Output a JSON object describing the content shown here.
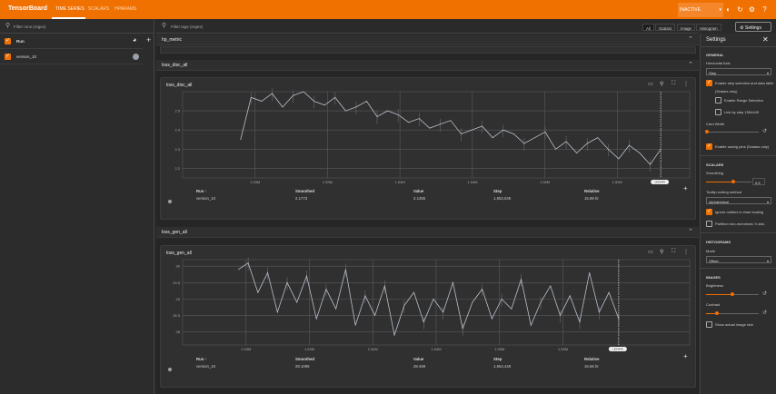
{
  "header": {
    "title": "TensorBoard",
    "tabs": [
      "TIME SERIES",
      "SCALARS",
      "HPARAMS"
    ],
    "status": "INACTIVE"
  },
  "runs": {
    "filter_placeholder": "Filter runs (regex)",
    "header": "Run",
    "items": [
      {
        "name": "version_10",
        "checked": true
      }
    ]
  },
  "main": {
    "filter_placeholder": "Filter tags (regex)",
    "chips": [
      "All",
      "Scalars",
      "Image",
      "Histogram"
    ],
    "active_chip": "All",
    "settings_button": "Settings"
  },
  "groups": {
    "hp_metric": "hp_metric",
    "disc": "loss_disc_all",
    "gen": "loss_gen_all"
  },
  "table_headers": {
    "run": "Run ↑",
    "smoothed": "Smoothed",
    "value": "Value",
    "step": "Step",
    "relative": "Relative"
  },
  "cards": [
    {
      "title": "loss_disc_all",
      "run": "version_10",
      "smoothed": "2.1773",
      "value": "2.1355",
      "step": "1,553,049",
      "relative": "15.89 hr",
      "step_label": "1553049"
    },
    {
      "title": "loss_gen_all",
      "run": "version_10",
      "smoothed": "29.1095",
      "value": "28.469",
      "step": "1,554,449",
      "relative": "16.65 hr",
      "step_label": "1554449"
    }
  ],
  "chart_data": [
    {
      "type": "line",
      "title": "loss_disc_all",
      "xlim": [
        1525000,
        1560000
      ],
      "ylim": [
        2.15,
        2.6
      ],
      "yticks": [
        "2.5",
        "2.4",
        "2.3",
        "2.2"
      ],
      "ytick_values": [
        2.5,
        2.4,
        2.3,
        2.2
      ],
      "xticks": [
        "1.53M",
        "1.53M",
        "1.54M",
        "1.54M",
        "1.55M",
        "1.55M"
      ],
      "xtick_values": [
        1530000,
        1535000,
        1540000,
        1545000,
        1550000,
        1555000
      ],
      "x_start": 1529000,
      "x_end": 1558000,
      "values": [
        2.35,
        2.57,
        2.55,
        2.59,
        2.52,
        2.58,
        2.6,
        2.55,
        2.53,
        2.57,
        2.5,
        2.52,
        2.55,
        2.47,
        2.5,
        2.48,
        2.44,
        2.46,
        2.41,
        2.43,
        2.45,
        2.38,
        2.4,
        2.42,
        2.36,
        2.4,
        2.38,
        2.33,
        2.36,
        2.39,
        2.3,
        2.34,
        2.28,
        2.33,
        2.36,
        2.3,
        2.25,
        2.32,
        2.28,
        2.22,
        2.3
      ]
    },
    {
      "type": "line",
      "title": "loss_gen_all",
      "xlim": [
        1525000,
        1565000
      ],
      "ylim": [
        27.6,
        30.2
      ],
      "yticks": [
        "30",
        "29.5",
        "29",
        "28.5",
        "28"
      ],
      "ytick_values": [
        30,
        29.5,
        29,
        28.5,
        28
      ],
      "xticks": [
        "1.53M",
        "1.53M",
        "1.54M",
        "1.54M",
        "1.55M",
        "1.55M"
      ],
      "xtick_values": [
        1530000,
        1535000,
        1540000,
        1545000,
        1550000,
        1555000
      ],
      "x_start": 1529400,
      "x_end": 1559400,
      "values": [
        29.9,
        30.1,
        29.2,
        29.8,
        28.6,
        29.5,
        28.9,
        29.7,
        28.4,
        29.3,
        28.7,
        29.9,
        28.2,
        29.1,
        28.5,
        29.4,
        27.9,
        28.8,
        29.2,
        28.3,
        29.0,
        28.6,
        29.5,
        28.1,
        28.9,
        29.3,
        28.4,
        29.0,
        28.7,
        29.6,
        28.2,
        28.9,
        29.4,
        28.5,
        29.1,
        28.3,
        29.8,
        28.6,
        29.2,
        28.4
      ]
    }
  ],
  "settings": {
    "title": "Settings",
    "general": "GENERAL",
    "horizontal_axis_label": "Horizontal Axis",
    "horizontal_axis": "Step",
    "step_selection": "Enable step selection and data table",
    "scalars_only": "(Scalars only)",
    "range_selection": "Enable Range Selection",
    "link_by_step": "Link by step 1554449",
    "card_width": "Card Width",
    "saving_pins": "Enable saving pins (Scalars only)",
    "scalars": "SCALARS",
    "smoothing_label": "Smoothing",
    "smoothing": "0.6",
    "smoothing_value": 0.6,
    "tooltip_label": "Tooltip sorting method",
    "tooltip": "Alphabetical",
    "ignore_outliers": "Ignore outliers in chart scaling",
    "partition": "Partition non-monotonic X axis",
    "histograms": "HISTOGRAMS",
    "mode_label": "Mode",
    "mode": "Offset",
    "images": "IMAGES",
    "brightness_label": "Brightness",
    "brightness": 0.5,
    "contrast_label": "Contrast",
    "contrast": 0.2,
    "actual_size": "Show actual image size"
  },
  "colors": {
    "accent": "#f07000",
    "line": "#b8c0cc"
  }
}
